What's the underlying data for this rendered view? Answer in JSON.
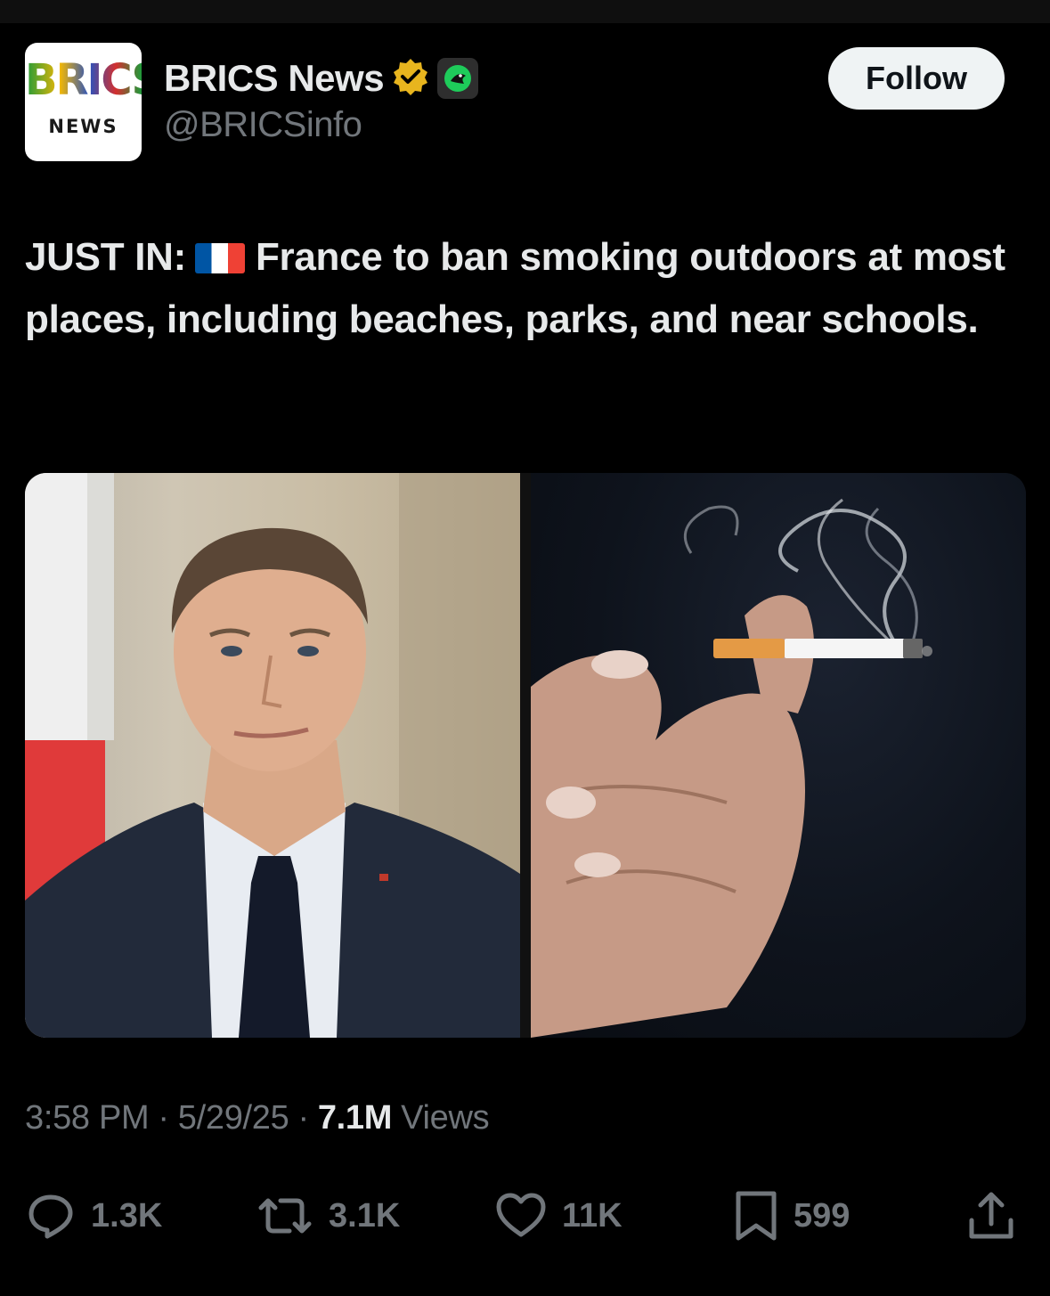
{
  "account": {
    "avatar_logo_top": "BRICS",
    "avatar_logo_bottom": "NEWS",
    "display_name": "BRICS News",
    "handle": "@BRICSinfo",
    "follow_label": "Follow",
    "verified_badge_color": "#e8b51e"
  },
  "tweet": {
    "prefix": "JUST IN:",
    "flag_icon": "france-flag-icon",
    "body": "France to ban smoking outdoors at most places, including beaches, parks, and near schools."
  },
  "meta": {
    "time": "3:58 PM",
    "separator": "·",
    "date": "5/29/25",
    "views_count": "7.1M",
    "views_label": "Views"
  },
  "actions": {
    "reply_count": "1.3K",
    "repost_count": "3.1K",
    "like_count": "11K",
    "bookmark_count": "599"
  },
  "colors": {
    "background": "#000000",
    "text_primary": "#e7e9ea",
    "text_secondary": "#71767b"
  }
}
